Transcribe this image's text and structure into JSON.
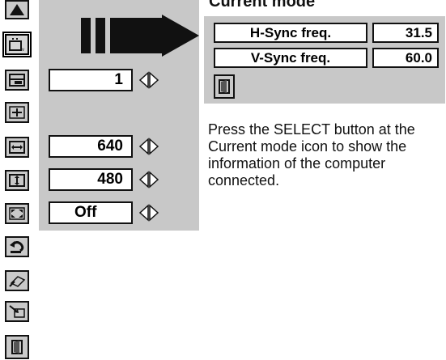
{
  "current_mode": {
    "title": "Current mode",
    "h_label": "H-Sync freq.",
    "h_value": "31.5",
    "v_label": "V-Sync freq.",
    "v_value": "60.0"
  },
  "menu": {
    "position_value": "1",
    "hsize_value": "640",
    "vsize_value": "480",
    "zoom_value": "Off"
  },
  "description": "Press the SELECT button at the Current mode icon to show the information of the computer connected.",
  "icons": [
    "up-arrow-icon",
    "current-mode-icon",
    "position-icon",
    "move-icon",
    "horizontal-size-icon",
    "vertical-size-icon",
    "zoom-icon",
    "reset-icon",
    "store-icon",
    "quit-icon",
    "exit-door-icon"
  ]
}
